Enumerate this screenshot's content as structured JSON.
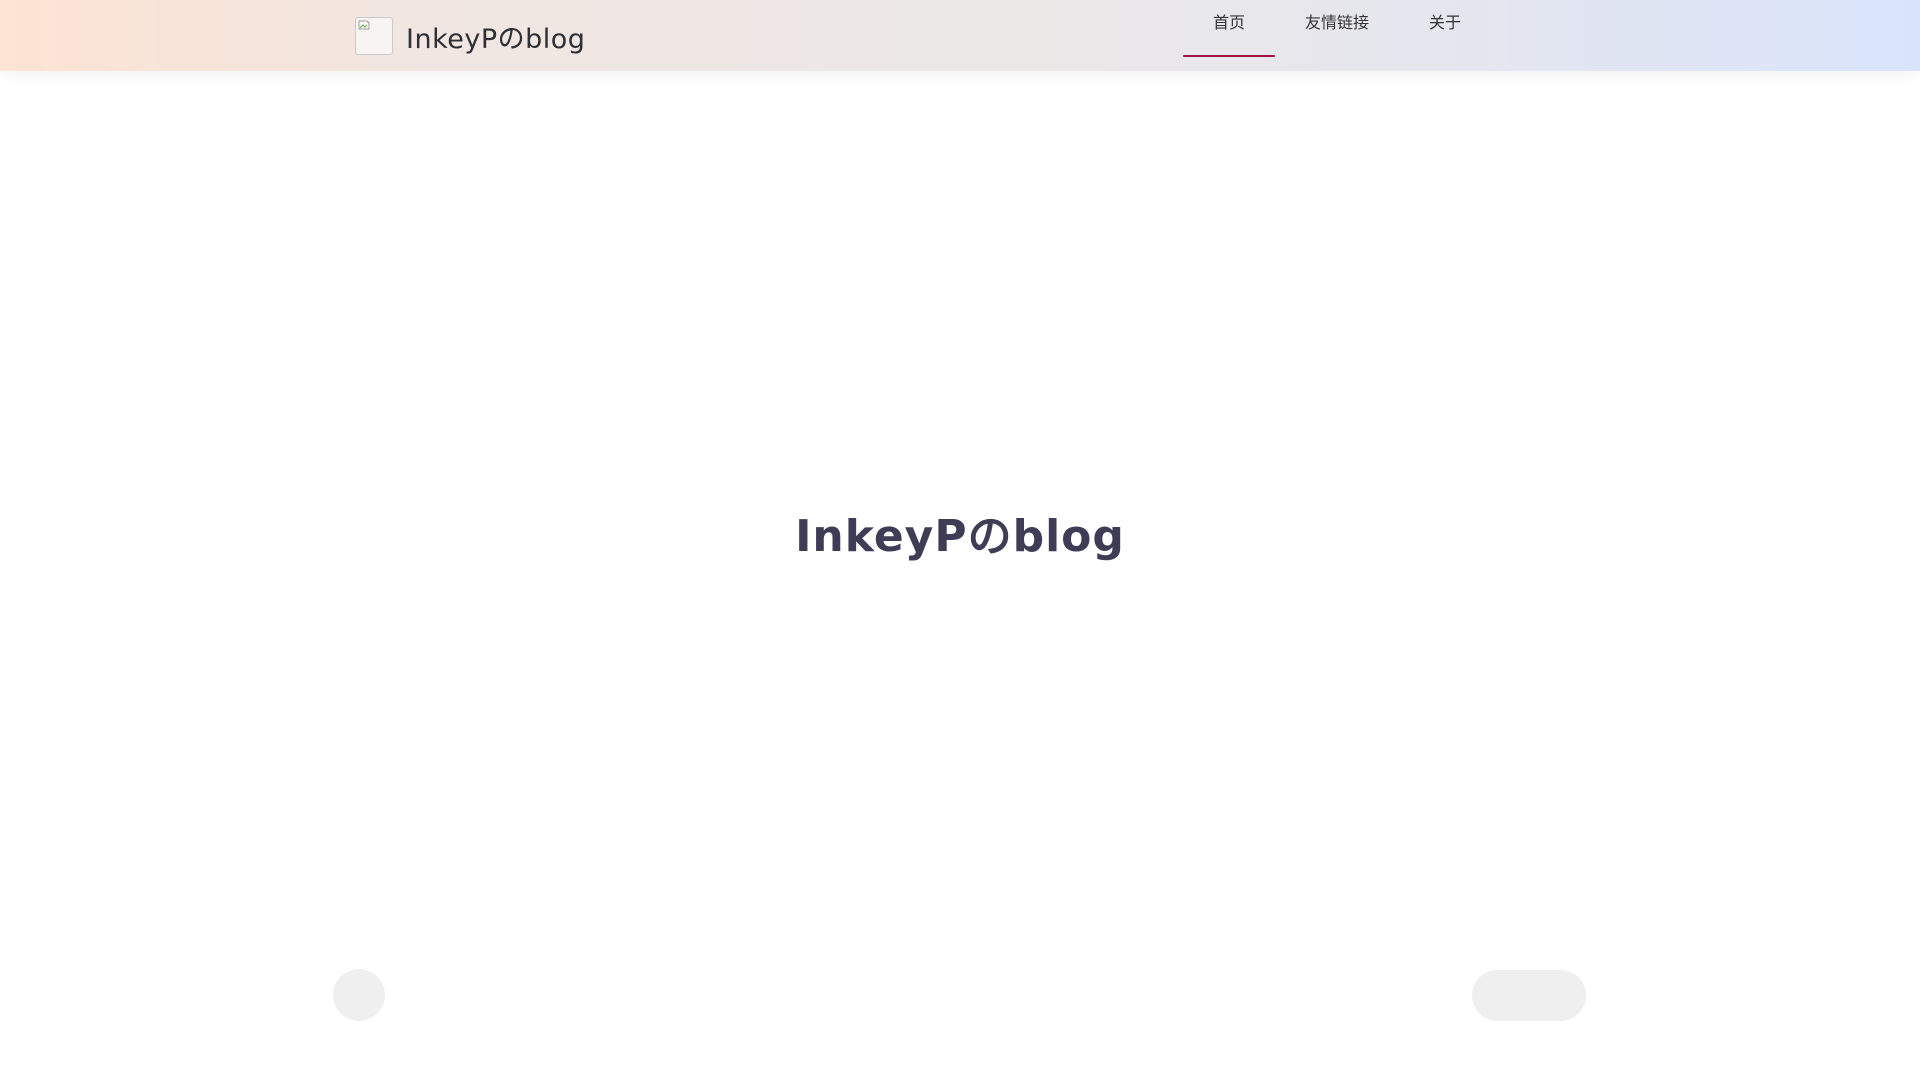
{
  "header": {
    "brand_name": "InkeyPのblog",
    "logo_icon": "broken-image-icon",
    "nav": [
      {
        "label": "首页",
        "active": true
      },
      {
        "label": "友情链接",
        "active": false
      },
      {
        "label": "关于",
        "active": false
      }
    ]
  },
  "hero": {
    "title": "InkeyPのblog"
  },
  "colors": {
    "nav_active_underline": "#a4123f",
    "title_text": "#3f3d56",
    "placeholder": "#efefef"
  }
}
